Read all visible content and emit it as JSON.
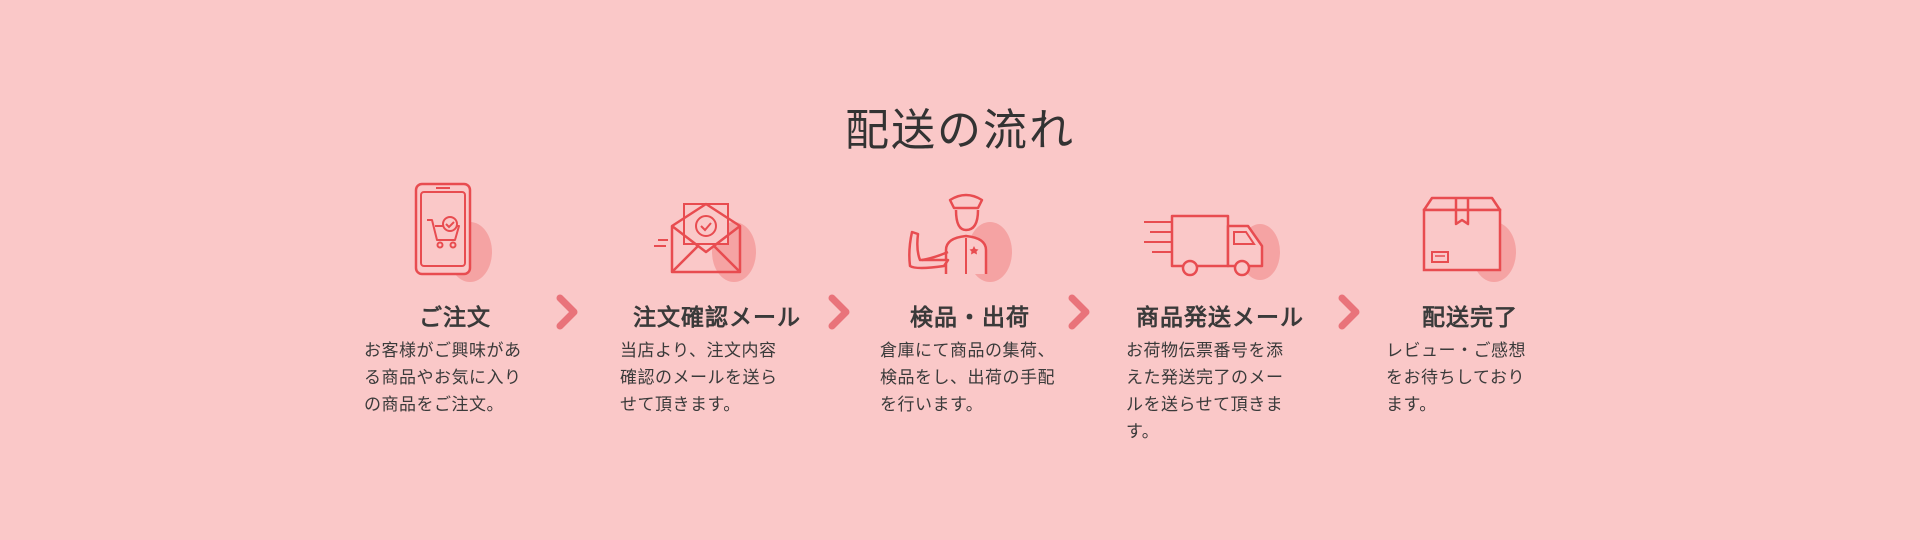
{
  "page": {
    "title": "配送の流れ",
    "background": "#fac8c8",
    "accent": "#e84c50",
    "blob": "#f5a3a3",
    "arrow_color": "#e9737a"
  },
  "steps": [
    {
      "icon": "smartphone-cart-icon",
      "title": "ご注文",
      "description": "お客様がご興味があ\nる商品やお気に入り\nの商品をご注文。"
    },
    {
      "icon": "envelope-check-icon",
      "title": "注文確認メール",
      "description": "当店より、注文内容\n確認のメールを送ら\nせて頂きます。"
    },
    {
      "icon": "inspector-icon",
      "title": "検品・出荷",
      "description": "倉庫にて商品の集荷、\n検品をし、出荷の手配\nを行います。"
    },
    {
      "icon": "delivery-truck-icon",
      "title": "商品発送メール",
      "description": "お荷物伝票番号を添\nえた発送完了のメー\nルを送らせて頂きま\nす。"
    },
    {
      "icon": "package-box-icon",
      "title": "配送完了",
      "description": "レビュー・ご感想\nをお待ちしており\nます。"
    }
  ]
}
